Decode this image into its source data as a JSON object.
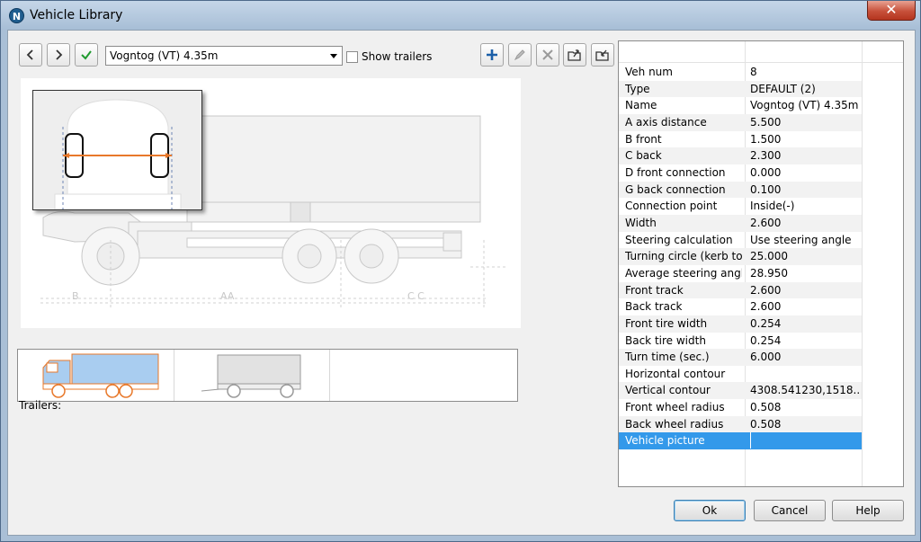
{
  "window": {
    "title": "Vehicle Library",
    "app_icon_letter": "N",
    "close_glyph": "✕"
  },
  "toolbar": {
    "vehicle_select_value": "Vogntog (VT) 4.35m",
    "show_trailers_label": "Show trailers",
    "show_trailers_checked": false,
    "icons": [
      "prev-icon",
      "next-icon",
      "checkmark-icon",
      "add-icon",
      "edit-icon",
      "delete-icon",
      "export-icon",
      "import-icon"
    ]
  },
  "preview": {
    "dimension_labels": [
      "B",
      "AA",
      "C C"
    ]
  },
  "thumbnails": {
    "trailers_label": "Trailers:",
    "items": [
      "truck",
      "trailer"
    ]
  },
  "properties": [
    {
      "key": "Veh num",
      "value": "8"
    },
    {
      "key": "Type",
      "value": "DEFAULT (2)"
    },
    {
      "key": "Name",
      "value": "Vogntog (VT) 4.35m"
    },
    {
      "key": "A axis distance",
      "value": "5.500"
    },
    {
      "key": "B front",
      "value": "1.500"
    },
    {
      "key": "C back",
      "value": "2.300"
    },
    {
      "key": "D front connection",
      "value": "0.000"
    },
    {
      "key": "G back connection",
      "value": "0.100"
    },
    {
      "key": "Connection point",
      "value": "Inside(-)"
    },
    {
      "key": "Width",
      "value": "2.600"
    },
    {
      "key": "Steering calculation",
      "value": "Use steering angle"
    },
    {
      "key": "Turning circle (kerb to...",
      "value": "25.000"
    },
    {
      "key": "Average steering angle",
      "value": "28.950"
    },
    {
      "key": "Front track",
      "value": "2.600"
    },
    {
      "key": "Back track",
      "value": "2.600"
    },
    {
      "key": "Front tire width",
      "value": "0.254"
    },
    {
      "key": "Back tire width",
      "value": "0.254"
    },
    {
      "key": "Turn time (sec.)",
      "value": "6.000"
    },
    {
      "key": "Horizontal contour",
      "value": ""
    },
    {
      "key": "Vertical contour",
      "value": "4308.541230,1518...."
    },
    {
      "key": "Front wheel radius",
      "value": "0.508"
    },
    {
      "key": "Back wheel radius",
      "value": "0.508"
    },
    {
      "key": "Vehicle picture",
      "value": ""
    }
  ],
  "selected_property_index": 22,
  "buttons": {
    "ok": "Ok",
    "cancel": "Cancel",
    "help": "Help"
  },
  "colors": {
    "selection": "#3399ea",
    "accent_orange": "#e8782a",
    "truck_blue": "#a9cdf0"
  }
}
